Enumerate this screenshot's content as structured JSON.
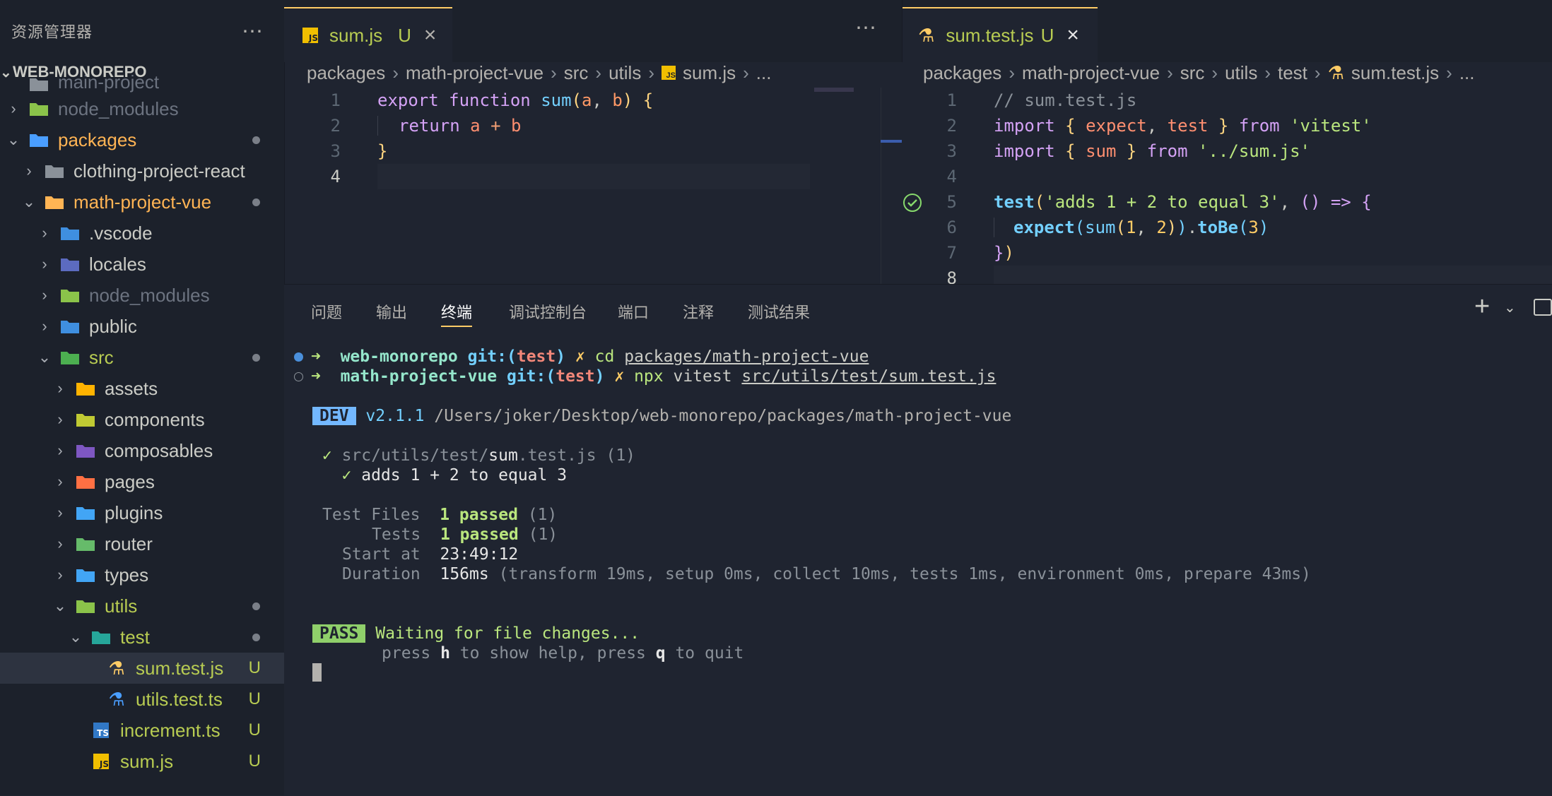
{
  "sidebar": {
    "title": "资源管理器",
    "more": "⋯",
    "workspace": "WEB-MONOREPO",
    "items": [
      {
        "label": "main-project",
        "indent": 0,
        "chevron": "",
        "icon": "folder-icon",
        "partial": true
      },
      {
        "label": "node_modules",
        "indent": 0,
        "chevron": "›",
        "icon": "node-folder-icon",
        "dim": true
      },
      {
        "label": "packages",
        "indent": 0,
        "chevron": "⌄",
        "icon": "packages-folder-icon",
        "orange": true,
        "dot": true
      },
      {
        "label": "clothing-project-react",
        "indent": 1,
        "chevron": "›",
        "icon": "folder-icon"
      },
      {
        "label": "math-project-vue",
        "indent": 1,
        "chevron": "⌄",
        "icon": "folder-open-icon",
        "orange": true,
        "dot": true
      },
      {
        "label": ".vscode",
        "indent": 2,
        "chevron": "›",
        "icon": "vscode-folder-icon"
      },
      {
        "label": "locales",
        "indent": 2,
        "chevron": "›",
        "icon": "locales-folder-icon"
      },
      {
        "label": "node_modules",
        "indent": 2,
        "chevron": "›",
        "icon": "node-folder-icon",
        "dim": true
      },
      {
        "label": "public",
        "indent": 2,
        "chevron": "›",
        "icon": "public-folder-icon"
      },
      {
        "label": "src",
        "indent": 2,
        "chevron": "⌄",
        "icon": "src-folder-icon",
        "green": true,
        "dot": true
      },
      {
        "label": "assets",
        "indent": 3,
        "chevron": "›",
        "icon": "assets-folder-icon"
      },
      {
        "label": "components",
        "indent": 3,
        "chevron": "›",
        "icon": "components-folder-icon"
      },
      {
        "label": "composables",
        "indent": 3,
        "chevron": "›",
        "icon": "composables-folder-icon"
      },
      {
        "label": "pages",
        "indent": 3,
        "chevron": "›",
        "icon": "pages-folder-icon"
      },
      {
        "label": "plugins",
        "indent": 3,
        "chevron": "›",
        "icon": "plugins-folder-icon"
      },
      {
        "label": "router",
        "indent": 3,
        "chevron": "›",
        "icon": "router-folder-icon"
      },
      {
        "label": "types",
        "indent": 3,
        "chevron": "›",
        "icon": "types-folder-icon"
      },
      {
        "label": "utils",
        "indent": 3,
        "chevron": "⌄",
        "icon": "utils-folder-icon",
        "green": true,
        "dot": true
      },
      {
        "label": "test",
        "indent": 4,
        "chevron": "⌄",
        "icon": "test-folder-icon",
        "green": true,
        "dot": true
      },
      {
        "label": "sum.test.js",
        "indent": 5,
        "chevron": "",
        "icon": "test-js-file-icon",
        "green": true,
        "badge": "U",
        "selected": true
      },
      {
        "label": "utils.test.ts",
        "indent": 5,
        "chevron": "",
        "icon": "test-ts-file-icon",
        "green": true,
        "badge": "U"
      },
      {
        "label": "increment.ts",
        "indent": 4,
        "chevron": "",
        "icon": "ts-file-icon",
        "green": true,
        "badge": "U"
      },
      {
        "label": "sum.js",
        "indent": 4,
        "chevron": "",
        "icon": "js-file-icon",
        "green": true,
        "badge": "U"
      }
    ]
  },
  "editor_left": {
    "tab": {
      "label": "sum.js",
      "status": "U",
      "close": "×"
    },
    "more": "⋯",
    "breadcrumb": [
      "packages",
      "math-project-vue",
      "src",
      "utils",
      "sum.js",
      "..."
    ],
    "line_numbers": [
      "1",
      "2",
      "3",
      "4"
    ]
  },
  "editor_right": {
    "tab": {
      "label": "sum.test.js",
      "status": "U",
      "close": "×"
    },
    "breadcrumb": [
      "packages",
      "math-project-vue",
      "src",
      "utils",
      "test",
      "sum.test.js",
      "..."
    ],
    "line_numbers": [
      "1",
      "2",
      "3",
      "4",
      "5",
      "6",
      "7",
      "8"
    ]
  },
  "panel": {
    "tabs": [
      "问题",
      "输出",
      "终端",
      "调试控制台",
      "端口",
      "注释",
      "测试结果"
    ],
    "active_tab": "终端",
    "add": "+",
    "terminal": {
      "line1": {
        "dir": "web-monorepo",
        "git": "git:(",
        "branch": "test",
        "gitclose": ")",
        "x": "✗",
        "cmd": "cd",
        "arg": "packages/math-project-vue"
      },
      "line2": {
        "dir": "math-project-vue",
        "git": "git:(",
        "branch": "test",
        "gitclose": ")",
        "x": "✗",
        "cmd": "npx",
        "cmd2": "vitest",
        "arg": "src/utils/test/sum.test.js"
      },
      "dev_badge": "DEV",
      "version": "v2.1.1",
      "path": "/Users/joker/Desktop/web-monorepo/packages/math-project-vue",
      "file_check": "✓",
      "file_pre": "src/utils/test/",
      "file_mid": "sum",
      "file_post": ".test.js (1)",
      "test_check": "✓",
      "test_name": "adds 1 + 2 to equal 3",
      "files_label": "Test Files",
      "files_passed": "1 passed",
      "files_count": "(1)",
      "tests_label": "Tests",
      "tests_passed": "1 passed",
      "tests_count": "(1)",
      "start_label": "Start at",
      "start_value": "23:49:12",
      "duration_label": "Duration",
      "duration_value": "156ms",
      "duration_detail": "(transform 19ms, setup 0ms, collect 10ms, tests 1ms, environment 0ms, prepare 43ms)",
      "pass_badge": "PASS",
      "waiting": "Waiting for file changes...",
      "help_1": "press ",
      "help_h": "h",
      "help_2": " to show help, press ",
      "help_q": "q",
      "help_3": " to quit"
    }
  },
  "colors": {
    "accent": "#ffcc66",
    "untracked": "#b8cc52",
    "background": "#1f2430"
  }
}
